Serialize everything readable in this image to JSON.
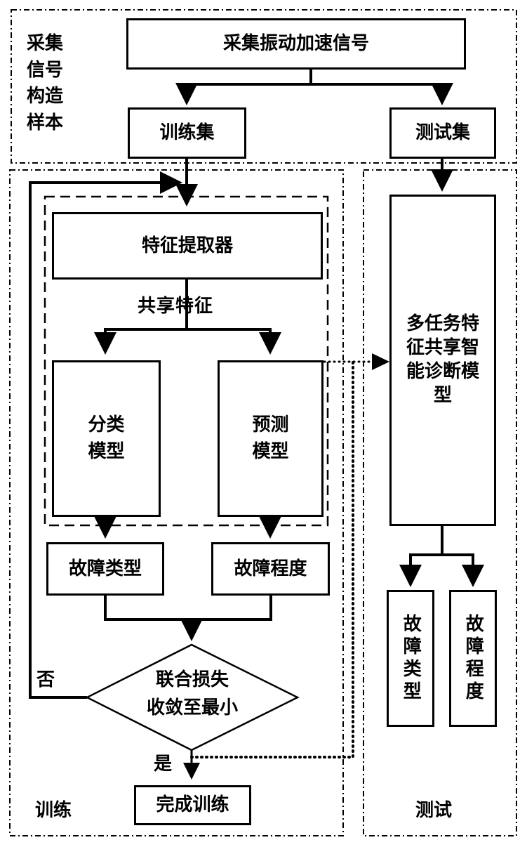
{
  "regions": {
    "collect": {
      "label": "采集信号构造样本"
    },
    "training": {
      "label": "训练"
    },
    "testing": {
      "label": "测试"
    }
  },
  "nodes": {
    "acquire_signal": "采集振动加速信号",
    "training_set": "训练集",
    "test_set": "测试集",
    "feature_extractor": "特征提取器",
    "classification_model": "分类模型",
    "prediction_model": "预测模型",
    "fault_type": "故障类型",
    "fault_degree": "故障程度",
    "decision": "联合损失收敛至最小",
    "decision_line1": "联合损失",
    "decision_line2": "收敛至最小",
    "finish_training": "完成训练",
    "multitask_model": "多任务特征共享智能诊断模型",
    "test_fault_type": "故障类型",
    "test_fault_degree": "故障程度"
  },
  "edge_labels": {
    "shared_features": "共享特征",
    "no": "否",
    "yes": "是"
  },
  "collect_label_lines": [
    "采集",
    "信号",
    "构造",
    "样本"
  ]
}
